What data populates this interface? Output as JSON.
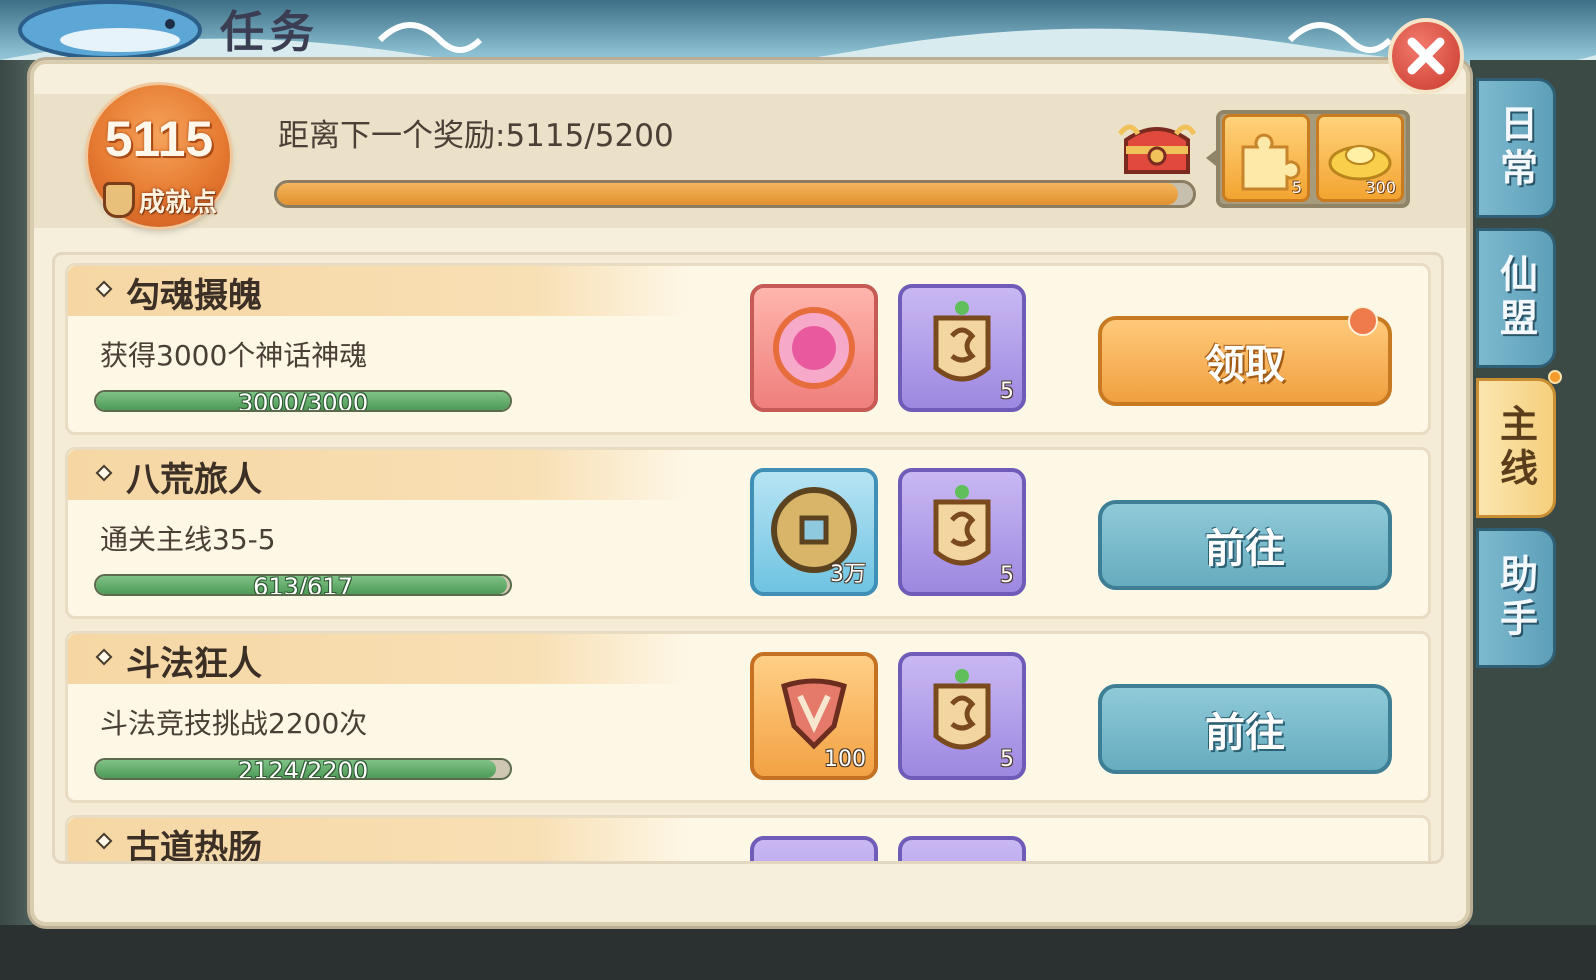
{
  "window": {
    "title": "任务"
  },
  "header": {
    "score_value": "5115",
    "score_label": "成就点",
    "progress_text": "距离下一个奖励:5115/5200",
    "progress_fraction": 0.984,
    "rewards": [
      {
        "icon": "puzzle-piece-icon",
        "count": "5"
      },
      {
        "icon": "gold-ingot-icon",
        "count": "300"
      }
    ]
  },
  "tasks": [
    {
      "title": "勾魂摄魄",
      "desc": "获得3000个神话神魂",
      "progress_text": "3000/3000",
      "progress_fraction": 1.0,
      "rewards": [
        {
          "icon": "soul-orb-icon",
          "count": ""
        },
        {
          "icon": "achievement-medal-icon",
          "count": "5"
        }
      ],
      "button": {
        "label": "领取",
        "state": "claim"
      }
    },
    {
      "title": "八荒旅人",
      "desc": "通关主线35-5",
      "progress_text": "613/617",
      "progress_fraction": 0.9935,
      "rewards": [
        {
          "icon": "copper-coin-icon",
          "count": "3万"
        },
        {
          "icon": "achievement-medal-icon",
          "count": "5"
        }
      ],
      "button": {
        "label": "前往",
        "state": "go"
      }
    },
    {
      "title": "斗法狂人",
      "desc": "斗法竞技挑战2200次",
      "progress_text": "2124/2200",
      "progress_fraction": 0.9655,
      "rewards": [
        {
          "icon": "arena-emblem-icon",
          "count": "100"
        },
        {
          "icon": "achievement-medal-icon",
          "count": "5"
        }
      ],
      "button": {
        "label": "前往",
        "state": "go"
      }
    },
    {
      "title": "古道热肠",
      "desc": "",
      "progress_text": "",
      "rewards": []
    }
  ],
  "side_tabs": [
    {
      "label": "日常",
      "active": false
    },
    {
      "label": "仙盟",
      "active": false
    },
    {
      "label": "主线",
      "active": true
    },
    {
      "label": "助手",
      "active": false
    }
  ],
  "colors": {
    "panel_bg": "#f6efdc",
    "progress_orange": "#e0922f",
    "progress_green": "#4e9a57",
    "button_claim": "#f0a040",
    "button_go": "#66acbf",
    "tab_active": "#f5cf7c",
    "tab_inactive": "#5e9fb8"
  }
}
